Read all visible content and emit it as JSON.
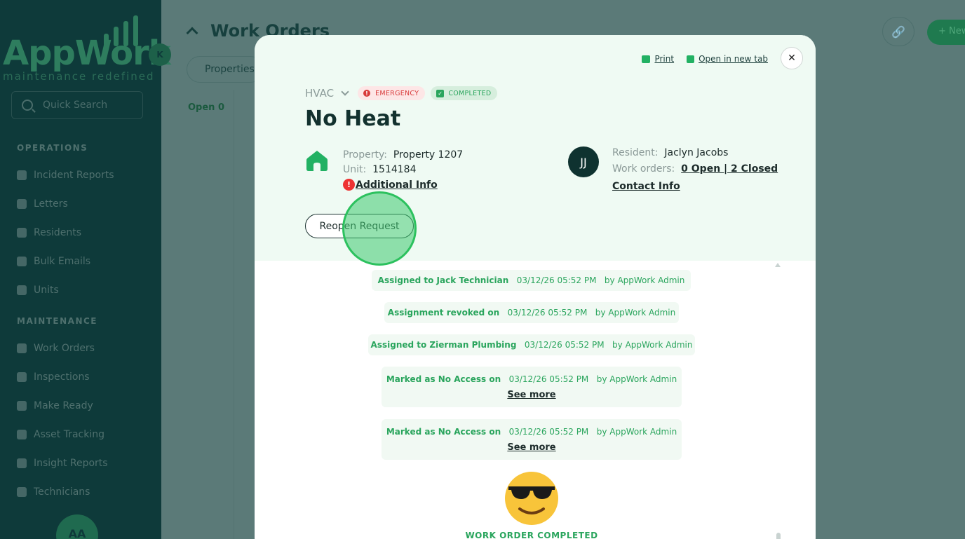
{
  "sidebar": {
    "logo_word": "AppWork",
    "logo_badge": "K",
    "logo_tagline": "maintenance redefined",
    "search_placeholder": "Quick Search",
    "sections": [
      {
        "heading": "OPERATIONS",
        "items": [
          "Incident Reports",
          "Letters",
          "Residents",
          "Bulk Emails",
          "Units"
        ]
      },
      {
        "heading": "MAINTENANCE",
        "items": [
          "Work Orders",
          "Inspections",
          "Make Ready",
          "Asset Tracking",
          "Insight Reports",
          "Technicians"
        ]
      }
    ],
    "user_initials": "AA"
  },
  "background": {
    "title": "Work Orders",
    "properties_filter": "Properties",
    "open_count": "Open 0",
    "new_button": "+ New"
  },
  "modal": {
    "print_label": "Print",
    "open_new_tab_label": "Open in new tab",
    "close_symbol": "✕",
    "category": "HVAC",
    "badges": {
      "emergency": "EMERGENCY",
      "completed": "COMPLETED"
    },
    "title": "No Heat",
    "property_label": "Property:",
    "property_value": "Property 1207",
    "unit_label": "Unit:",
    "unit_value": "1514184",
    "additional_info": "Additional Info",
    "resident_initials": "JJ",
    "resident_label": "Resident:",
    "resident_value": "Jaclyn Jacobs",
    "work_orders_label": "Work orders:",
    "work_orders_value": "0 Open | 2 Closed",
    "contact_info": "Contact Info",
    "reopen_button": "Reopen Request",
    "timeline": [
      {
        "action": "Assigned to Jack Technician",
        "time": "03/12/26 05:52 PM",
        "by": "by AppWork Admin"
      },
      {
        "action": "Assignment revoked on",
        "time": "03/12/26 05:52 PM",
        "by": "by AppWork Admin"
      },
      {
        "action": "Assigned to Zierman Plumbing",
        "time": "03/12/26 05:52 PM",
        "by": "by AppWork Admin"
      },
      {
        "action": "Marked as No Access on",
        "time": "03/12/26 05:52 PM",
        "by": "by AppWork Admin",
        "see_more": "See more"
      },
      {
        "action": "Marked as No Access on",
        "time": "03/12/26 05:52 PM",
        "by": "by AppWork Admin",
        "see_more": "See more"
      }
    ],
    "completed_text": "WORK ORDER COMPLETED"
  },
  "colors": {
    "sidebar_bg": "#0e3a3a",
    "accent_green": "#2aa55d",
    "emergency_red": "#d83a3a",
    "overlay": "#5b7a78"
  }
}
